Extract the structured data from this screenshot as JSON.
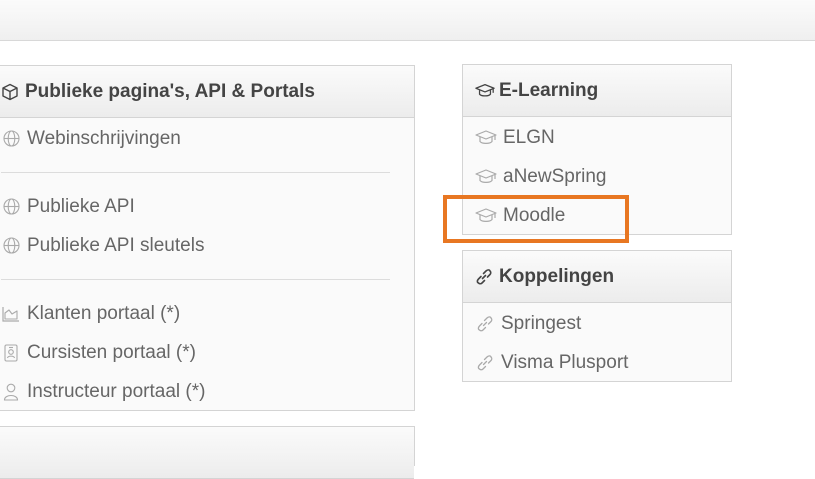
{
  "public_panel": {
    "title": "Publieke pagina's, API & Portals",
    "items": [
      {
        "label": "Webinschrijvingen",
        "icon": "globe-icon"
      },
      {
        "label": "Publieke API",
        "icon": "globe-icon"
      },
      {
        "label": "Publieke API sleutels",
        "icon": "globe-icon"
      },
      {
        "label": "Klanten portaal (*)",
        "icon": "area-chart-icon"
      },
      {
        "label": "Cursisten portaal (*)",
        "icon": "id-badge-icon"
      },
      {
        "label": "Instructeur portaal (*)",
        "icon": "user-icon"
      }
    ]
  },
  "elearning_panel": {
    "title": "E-Learning",
    "items": [
      {
        "label": "ELGN",
        "icon": "graduation-cap-icon"
      },
      {
        "label": "aNewSpring",
        "icon": "graduation-cap-icon"
      },
      {
        "label": "Moodle",
        "icon": "graduation-cap-icon"
      }
    ]
  },
  "koppelingen_panel": {
    "title": "Koppelingen",
    "items": [
      {
        "label": "Springest",
        "icon": "link-icon"
      },
      {
        "label": "Visma Plusport",
        "icon": "link-icon"
      }
    ]
  },
  "colors": {
    "highlight": "#e87722"
  }
}
